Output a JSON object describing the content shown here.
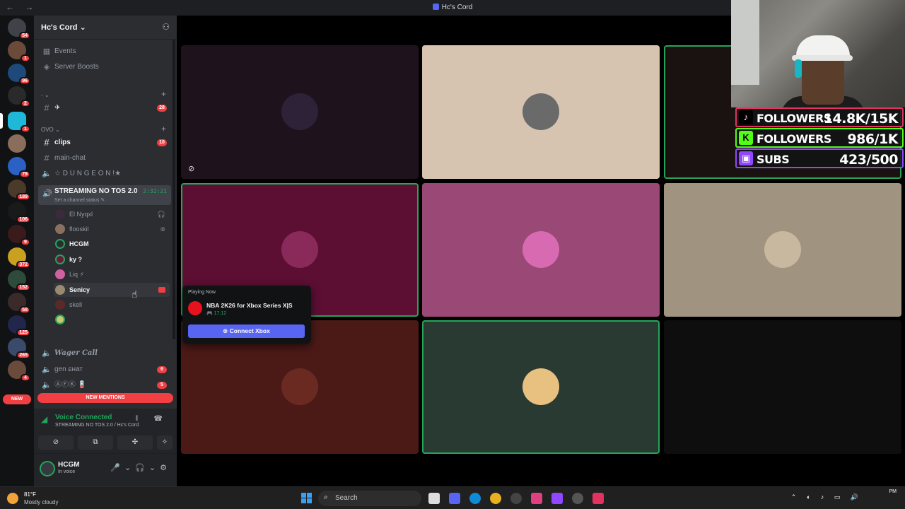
{
  "window": {
    "title": "Hc's Cord",
    "nav": "← →"
  },
  "rail": {
    "badges": [
      "54",
      "1",
      "96",
      "2",
      "1",
      "",
      "79",
      "189",
      "106",
      "9",
      "372",
      "152",
      "58",
      "125",
      "265",
      "4"
    ],
    "new_label": "NEW"
  },
  "guild": {
    "name": "Hc's Cord ⌄"
  },
  "menu": {
    "events": "Events",
    "server_boosts": "Server Boosts"
  },
  "categories": {
    "c1": "- ⌄",
    "ovo": "OVO ⌄"
  },
  "channels": [
    {
      "name": "✈",
      "badge": "28"
    },
    {
      "name": "clips",
      "badge": "10"
    },
    {
      "name": "main-chat",
      "badge": ""
    },
    {
      "name": "☆ D U N G E O N !★",
      "badge": ""
    }
  ],
  "voice_channel": {
    "name": "STREAMING NO TOS 2.0",
    "status": "Set a channel status ✎",
    "time": "2:32:21"
  },
  "voice_users": [
    {
      "name": "El Nyqxl",
      "status_icon": "🎧"
    },
    {
      "name": "flooskil",
      "status_icon": "⊗"
    },
    {
      "name": "HCGM",
      "status_icon": ""
    },
    {
      "name": "ky ?",
      "status_icon": ""
    },
    {
      "name": "Liq ⚡",
      "status_icon": ""
    },
    {
      "name": "Senicy",
      "status_icon": ""
    },
    {
      "name": "skell",
      "status_icon": ""
    },
    {
      "name": "",
      "status_icon": ""
    }
  ],
  "lower_channels": [
    {
      "name": "Wager Call",
      "badge": ""
    },
    {
      "name": "gen ɕнат",
      "badge": "6"
    },
    {
      "name": "ⒶⒻⓀ 🪫",
      "badge": "5"
    }
  ],
  "new_mentions": "NEW MENTIONS",
  "voice_panel": {
    "title": "Voice Connected",
    "subtitle": "STREAMING NO TOS 2.0 / Hc's Cord"
  },
  "user_panel": {
    "name": "HCGM",
    "status": "In voice"
  },
  "popup": {
    "header": "Playing Now",
    "game": "NBA 2K26 for Xbox Series X|S",
    "elapsed": "🎮 17:12",
    "button": "Connect Xbox"
  },
  "overlay": {
    "stats": [
      {
        "label": "FOLLOWERS",
        "value": "14.8K/15K",
        "icon": "♪",
        "color": "#e3325f"
      },
      {
        "label": "FOLLOWERS",
        "value": "986/1K",
        "icon": "K",
        "color": "#53fc18"
      },
      {
        "label": "SUBS",
        "value": "423/500",
        "icon": "▣",
        "color": "#9146ff"
      }
    ]
  },
  "taskbar": {
    "temp": "81°F",
    "weather": "Mostly cloudy",
    "search": "Search",
    "clock_time": "PM"
  },
  "colors": {
    "accent": "#5865f2",
    "online": "#23a55a",
    "danger": "#f23f43"
  }
}
